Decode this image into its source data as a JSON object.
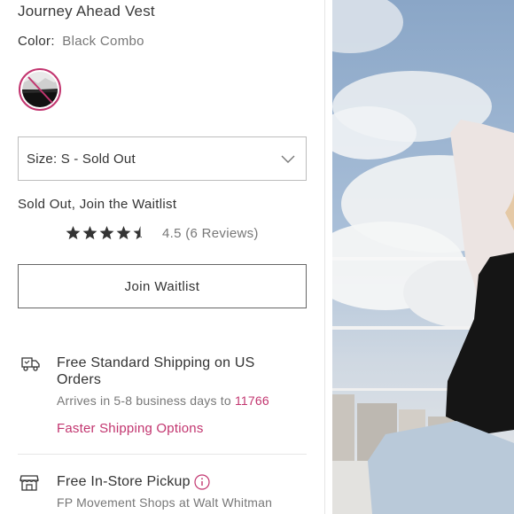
{
  "product": {
    "title": "Journey Ahead Vest",
    "color_label": "Color:",
    "color_value": "Black Combo",
    "swatch_state": "sold-out"
  },
  "size_select": {
    "label": "Size:",
    "value": "S - Sold Out"
  },
  "availability": {
    "message": "Sold Out, Join the Waitlist"
  },
  "rating": {
    "stars": 4.5,
    "max_stars": 5,
    "text": "4.5 (6 Reviews)"
  },
  "waitlist_button": {
    "label": "Join Waitlist"
  },
  "shipping": {
    "icon": "delivery-truck-icon",
    "heading": "Free Standard Shipping on US Orders",
    "arrival_prefix": "Arrives in 5-8 business days to",
    "zip": "11766",
    "faster_link": "Faster Shipping Options"
  },
  "pickup": {
    "icon": "storefront-icon",
    "heading": "Free In-Store Pickup",
    "subtext": "FP Movement Shops at Walt Whitman"
  },
  "colors": {
    "accent": "#c2356f",
    "text": "#333333",
    "muted": "#777777",
    "border": "#bdbdbd"
  }
}
